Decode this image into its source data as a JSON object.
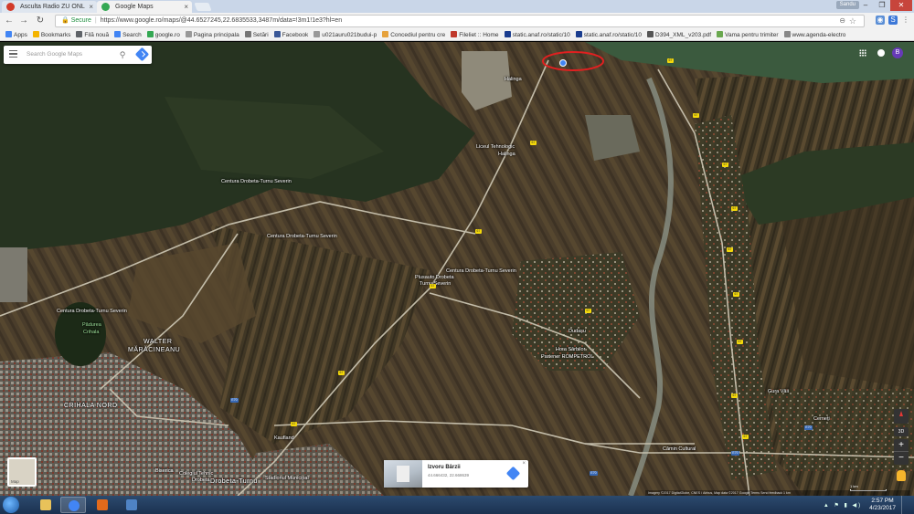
{
  "browser": {
    "tabs": [
      {
        "title": "Asculta Radio ZU ONL",
        "active": false,
        "favicon_color": "#d23a2a"
      },
      {
        "title": "Google Maps",
        "active": true,
        "favicon_color": "#34a853"
      }
    ],
    "close_glyph": "×",
    "profile_name": "Sandu",
    "window_controls": {
      "minimize": "–",
      "maximize": "❐",
      "close": "✕"
    },
    "nav": {
      "back": "←",
      "forward": "→",
      "reload": "↻"
    },
    "omnibox": {
      "secure_label": "Secure",
      "url": "https://www.google.ro/maps/@44.6527245,22.6835533,3487m/data=!3m1!1e3?hl=en"
    },
    "bookmarks": [
      {
        "label": "Apps",
        "icon_color": "#4285f4"
      },
      {
        "label": "Bookmarks",
        "icon_color": "#f4b400"
      },
      {
        "label": "Filă nouă",
        "icon_color": "#5f6368"
      },
      {
        "label": "Search",
        "icon_color": "#4285f4"
      },
      {
        "label": "google.ro",
        "icon_color": "#34a853"
      },
      {
        "label": "Pagina principala",
        "icon_color": "#999999"
      },
      {
        "label": "Setări",
        "icon_color": "#777777"
      },
      {
        "label": "Facebook",
        "icon_color": "#3b5998"
      },
      {
        "label": "u021auru021budui-p",
        "icon_color": "#999999"
      },
      {
        "label": "Concediul pentru cre",
        "icon_color": "#e6a23c"
      },
      {
        "label": "Fileliet :: Home",
        "icon_color": "#c0392b"
      },
      {
        "label": "static.anaf.ro/static/10",
        "icon_color": "#1a3d8f"
      },
      {
        "label": "static.anaf.ro/static/10",
        "icon_color": "#1a3d8f"
      },
      {
        "label": "D394_XML_v203.pdf",
        "icon_color": "#555555"
      },
      {
        "label": "Vama pentru trimiter",
        "icon_color": "#6aa84f"
      },
      {
        "label": "www.agenda-electro",
        "icon_color": "#888888"
      }
    ]
  },
  "map": {
    "search_placeholder": "Search Google Maps",
    "account_initial": "B",
    "labels": [
      {
        "text": "Halinga",
        "kind": "small"
      },
      {
        "text": "Liceul Tehnologic",
        "kind": "small"
      },
      {
        "text": "Halinga",
        "kind": "small"
      },
      {
        "text": "Centura Drobeta-Turnu Severin",
        "kind": "small"
      },
      {
        "text": "Centura Drobeta-Turnu Severin",
        "kind": "small"
      },
      {
        "text": "Centura Drobeta-Turnu Severin",
        "kind": "small"
      },
      {
        "text": "Centura Drobeta-Turnu Severin",
        "kind": "small"
      },
      {
        "text": "Plusauto Drobeta",
        "kind": "small"
      },
      {
        "text": "Turnu Severin",
        "kind": "small"
      },
      {
        "text": "Pădurea",
        "kind": "green"
      },
      {
        "text": "Crihala",
        "kind": "green"
      },
      {
        "text": "WALTER",
        "kind": "big"
      },
      {
        "text": "MĂRĂCINEANU",
        "kind": "big"
      },
      {
        "text": "CRIHALA NORD",
        "kind": "big"
      },
      {
        "text": "Dudașu",
        "kind": "small"
      },
      {
        "text": "Hora Sârbilor",
        "kind": "small"
      },
      {
        "text": "Partener ROMPETROL",
        "kind": "small"
      },
      {
        "text": "Gura Văii",
        "kind": "small"
      },
      {
        "text": "Cerneți",
        "kind": "small"
      },
      {
        "text": "Kaufland",
        "kind": "small"
      },
      {
        "text": "Cămin Cultural",
        "kind": "small"
      },
      {
        "text": "Drobeta-Turnu",
        "kind": "big"
      },
      {
        "text": "Stadionul Municipal",
        "kind": "small"
      },
      {
        "text": "Biserica",
        "kind": "small"
      },
      {
        "text": "Colegiul Tehnic",
        "kind": "small"
      },
      {
        "text": "Drobeta",
        "kind": "small"
      }
    ],
    "road_shields": [
      {
        "ref": "67",
        "type": "county"
      },
      {
        "ref": "67",
        "type": "county"
      },
      {
        "ref": "67",
        "type": "county"
      },
      {
        "ref": "67",
        "type": "county"
      },
      {
        "ref": "67",
        "type": "county"
      },
      {
        "ref": "67",
        "type": "county"
      },
      {
        "ref": "67",
        "type": "county"
      },
      {
        "ref": "67",
        "type": "county"
      },
      {
        "ref": "67",
        "type": "county"
      },
      {
        "ref": "67",
        "type": "county"
      },
      {
        "ref": "67",
        "type": "county"
      },
      {
        "ref": "67",
        "type": "county"
      },
      {
        "ref": "67",
        "type": "county"
      },
      {
        "ref": "67",
        "type": "county"
      },
      {
        "ref": "67",
        "type": "county"
      },
      {
        "ref": "E70",
        "type": "euro"
      },
      {
        "ref": "E70",
        "type": "euro"
      },
      {
        "ref": "E70",
        "type": "euro"
      },
      {
        "ref": "E70",
        "type": "euro"
      }
    ],
    "thumbnail_label": "Map",
    "info_card": {
      "title": "Izvoru Bârzii",
      "subtitle": "44.666432, 22.668639",
      "close": "×"
    },
    "controls": {
      "zoom_in": "+",
      "zoom_out": "−",
      "view_3d": "3D",
      "tilt": "▲"
    },
    "attribution": "Imagery ©2017 DigitalGlobe, CNES / Airbus, Map data ©2017 Google   Terms   Send feedback   1 km",
    "scale_label": "1 km",
    "highlight_color": "#e02020"
  },
  "taskbar": {
    "clock_time": "2:57 PM",
    "clock_date": "4/23/2017",
    "tray_glyphs": "▲ ⚑ ▮ ◀)",
    "items": [
      {
        "name": "file-explorer",
        "color": "#e8c25a",
        "active": false
      },
      {
        "name": "chrome",
        "color": "#4285f4",
        "active": true
      },
      {
        "name": "media-player",
        "color": "#e36a1b",
        "active": false
      },
      {
        "name": "remote-desktop",
        "color": "#4f83c4",
        "active": false
      }
    ]
  }
}
